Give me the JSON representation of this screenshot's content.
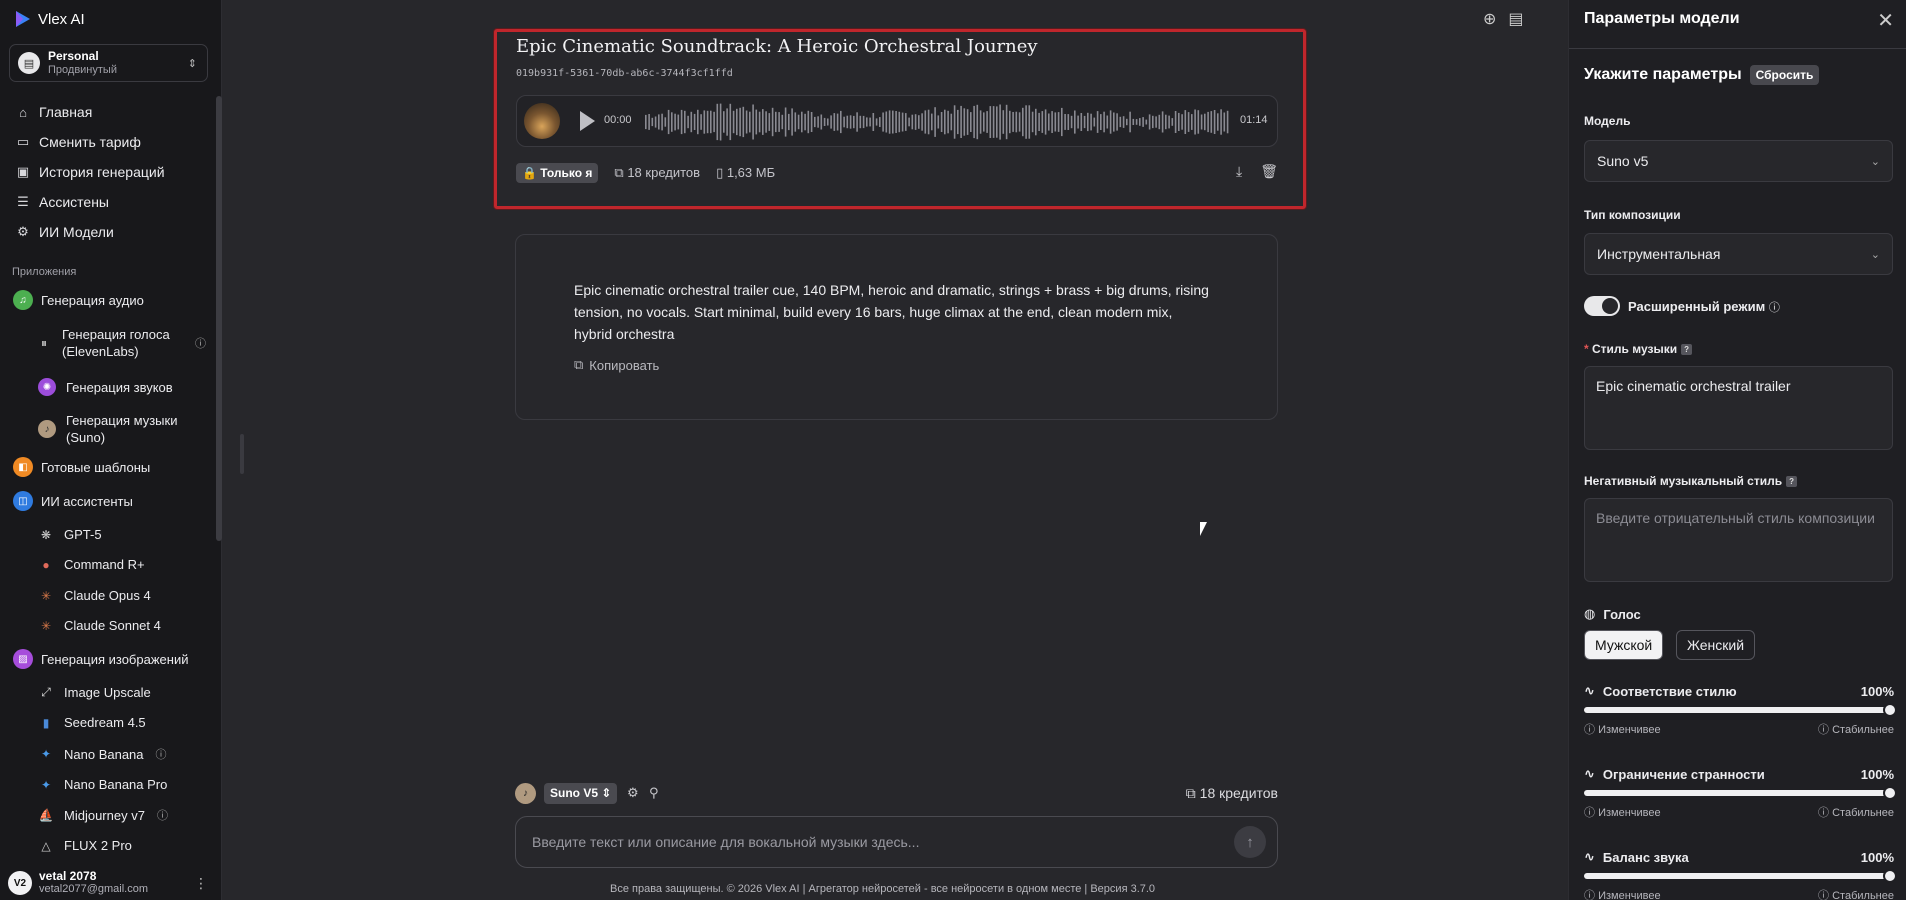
{
  "app": {
    "name": "Vlex AI"
  },
  "workspace": {
    "name": "Personal",
    "plan": "Продвинутый"
  },
  "nav": [
    {
      "label": "Главная",
      "icon": "home-icon"
    },
    {
      "label": "Сменить тариф",
      "icon": "card-icon"
    },
    {
      "label": "История генераций",
      "icon": "history-icon"
    },
    {
      "label": "Ассистены",
      "icon": "assistant-icon"
    },
    {
      "label": "ИИ Модели",
      "icon": "chip-icon"
    }
  ],
  "apps_label": "Приложения",
  "apps": {
    "audio": {
      "label": "Генерация аудио",
      "color": "#4caf50"
    },
    "voice": {
      "label": "Генерация голоса (ElevenLabs)"
    },
    "sounds": {
      "label": "Генерация звуков",
      "color": "#9c4ddb"
    },
    "music": {
      "label": "Генерация музыки (Suno)"
    },
    "templates": {
      "label": "Готовые шаблоны",
      "color": "#f08a24"
    },
    "assistants": {
      "label": "ИИ ассистенты",
      "color": "#2f7be0"
    },
    "gpt5": {
      "label": "GPT-5"
    },
    "command": {
      "label": "Command R+"
    },
    "opus": {
      "label": "Claude Opus 4"
    },
    "sonnet": {
      "label": "Claude Sonnet 4"
    },
    "images": {
      "label": "Генерация изображений",
      "color": "#a64ddb"
    },
    "upscale": {
      "label": "Image Upscale"
    },
    "seedream": {
      "label": "Seedream 4.5"
    },
    "nano": {
      "label": "Nano Banana"
    },
    "nanopro": {
      "label": "Nano Banana Pro"
    },
    "midjourney": {
      "label": "Midjourney v7"
    },
    "flux": {
      "label": "FLUX 2 Pro"
    }
  },
  "user": {
    "initials": "V2",
    "name": "vetal 2078",
    "email": "vetal2077@gmail.com"
  },
  "track": {
    "title": "Epic Cinematic Soundtrack: A Heroic Orchestral Journey",
    "id": "019b931f-5361-70db-ab6c-3744f3cf1ffd",
    "current_time": "00:00",
    "duration": "01:14",
    "privacy": "Только я",
    "credits": "18 кредитов",
    "size": "1,63 МБ"
  },
  "prompt": {
    "text": "Epic cinematic orchestral trailer cue, 140 BPM, heroic and dramatic, strings + brass + big drums, rising tension, no vocals. Start minimal, build every 16 bars, huge climax at the end, clean modern mix, hybrid orchestra",
    "copy_label": "Копировать"
  },
  "composer": {
    "model": "Suno V5",
    "credits": "18 кредитов",
    "placeholder": "Введите текст или описание для вокальной музыки здесь..."
  },
  "footer": "Все права защищены. © 2026 Vlex AI | Агрегатор нейросетей - все нейросети в одном месте | Версия 3.7.0",
  "panel": {
    "header": "Параметры модели",
    "title": "Укажите параметры",
    "reset": "Сбросить",
    "model_label": "Модель",
    "model_value": "Suno v5",
    "type_label": "Тип композиции",
    "type_value": "Инструментальная",
    "advanced_label": "Расширенный режим",
    "advanced_on": true,
    "style_label": "Стиль музыки",
    "style_value": "Epic cinematic orchestral trailer",
    "negative_label": "Негативный музыкальный стиль",
    "negative_placeholder": "Введите отрицательный стиль композиции",
    "voice_label": "Голос",
    "voice_male": "Мужской",
    "voice_female": "Женский",
    "voice_selected": "Мужской",
    "sliders": [
      {
        "label": "Соответствие стилю",
        "value": "100%",
        "level": 1.0,
        "left": "Изменчивее",
        "right": "Стабильнее"
      },
      {
        "label": "Ограничение странности",
        "value": "100%",
        "level": 1.0,
        "left": "Изменчивее",
        "right": "Стабильнее"
      },
      {
        "label": "Баланс звука",
        "value": "100%",
        "level": 1.0,
        "left": "Изменчивее",
        "right": "Стабильнее"
      }
    ]
  }
}
